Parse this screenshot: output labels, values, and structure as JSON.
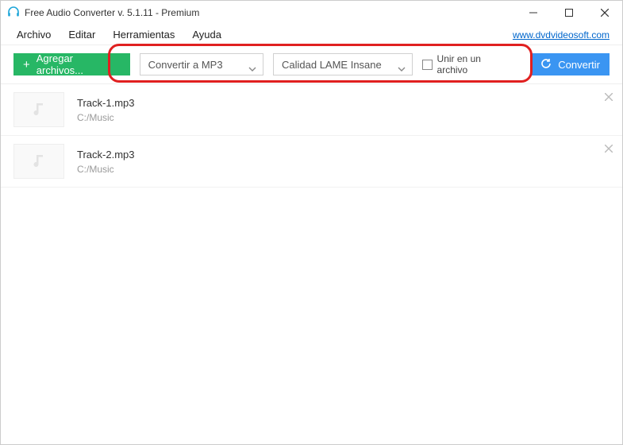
{
  "window": {
    "title": "Free Audio Converter v. 5.1.11 - Premium"
  },
  "menu": {
    "items": [
      "Archivo",
      "Editar",
      "Herramientas",
      "Ayuda"
    ],
    "site_link": "www.dvdvideosoft.com"
  },
  "toolbar": {
    "add_label": "Agregar archivos...",
    "format_selected": "Convertir a MP3",
    "quality_selected": "Calidad LAME Insane",
    "merge_label": "Unir en un archivo",
    "convert_label": "Convertir"
  },
  "files": [
    {
      "name": "Track-1.mp3",
      "path": "C:/Music"
    },
    {
      "name": "Track-2.mp3",
      "path": "C:/Music"
    }
  ],
  "icons": {
    "music_note_color": "#d9d9d9",
    "accent_green": "#27b765",
    "accent_blue": "#3a95f2",
    "highlight_red": "#e02020",
    "headphone_color": "#1fa6d9"
  }
}
